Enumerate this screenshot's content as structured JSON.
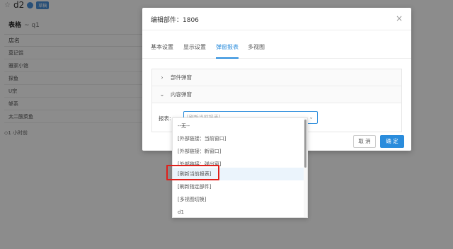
{
  "background": {
    "page_title": "d2",
    "badge": "草稿",
    "widget_title": "表格",
    "widget_subtitle": "~ q1",
    "column_header": "店名",
    "rows": [
      "莫记馄",
      "雅家小馆",
      "探鱼",
      "U宗",
      "够系",
      "太二酸菜鱼"
    ],
    "updated": "◇1 小时前"
  },
  "modal": {
    "title": "编辑部件：1806",
    "close": "×",
    "tabs": [
      "基本设置",
      "显示设置",
      "弹窗报表",
      "多视图"
    ],
    "active_tab": 2,
    "sections": [
      {
        "label": "部件弹窗",
        "chevron": "›"
      },
      {
        "label": "内容弹窗",
        "chevron": "⌄"
      }
    ],
    "field_label": "报表:",
    "select_placeholder": "[刷新当前报表]",
    "select_arrow": "⌄",
    "cancel_label": "取 消",
    "ok_label": "确 定"
  },
  "dropdown": {
    "options": [
      "--无--",
      "[外部链接：当前窗口]",
      "[外部链接：新窗口]",
      "[外部链接：弹出窗]",
      "[刷新当前报表]",
      "[刷新指定部件]",
      "[多视图切换]",
      "d1"
    ],
    "highlighted_index": 4
  },
  "colors": {
    "accent": "#2a8cdc",
    "highlight_box": "#e0201b"
  }
}
